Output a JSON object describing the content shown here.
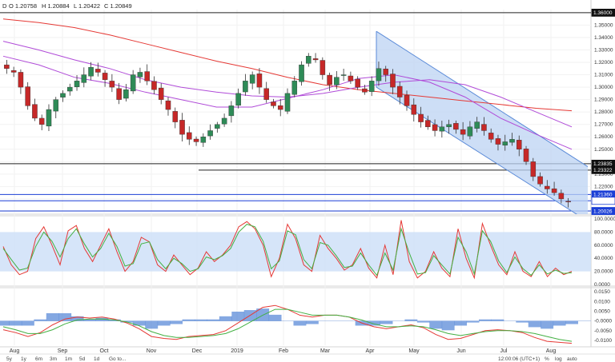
{
  "header": {
    "symbol_interval": "D",
    "open": "O 1.20758",
    "high": "H 1.20884",
    "low": "L 1.20422",
    "close": "C 1.20849"
  },
  "toolbar": {
    "ranges": [
      "5y",
      "1y",
      "6m",
      "3m",
      "1m",
      "5d",
      "1d",
      "Go to..."
    ],
    "time": "12:00:06 (UTC+1)",
    "scale_options": [
      "%",
      "log",
      "auto"
    ]
  },
  "colors": {
    "bull": "#2e8b57",
    "bear": "#c62828",
    "channel_fill": "#bcd3f3",
    "channel_line": "#5b8bd8",
    "ma_red": "#e53935",
    "ma_purple": "#b04bd8",
    "rsi_band": "#cfe0f8",
    "stoch_k": "#e53935",
    "stoch_d": "#43b043",
    "hist": "#5b8bd8"
  },
  "chart_data": [
    {
      "type": "line",
      "name": "price",
      "x_labels": [
        "Aug",
        "Sep",
        "Oct",
        "Nov",
        "Dec",
        "2019",
        "Feb",
        "Mar",
        "Apr",
        "May",
        "Jun",
        "Jul",
        "Aug"
      ],
      "y_ticks": [
        "1.35000",
        "1.34000",
        "1.33000",
        "1.32000",
        "1.31000",
        "1.30000",
        "1.29000",
        "1.28000",
        "1.27000",
        "1.26000",
        "1.25000",
        "1.24000",
        "1.23000",
        "1.22000",
        "1.21000",
        "1.20000"
      ],
      "ylim": [
        1.199,
        1.3625
      ],
      "price_labels": [
        "1.36000",
        "1.23835",
        "1.23322",
        "1.21360",
        "1.20849",
        "1.20026"
      ],
      "close_series": [
        1.315,
        1.312,
        1.3,
        1.285,
        1.275,
        1.27,
        1.282,
        1.29,
        1.295,
        1.3,
        1.305,
        1.31,
        1.316,
        1.312,
        1.306,
        1.3,
        1.29,
        1.298,
        1.31,
        1.312,
        1.305,
        1.298,
        1.29,
        1.282,
        1.272,
        1.262,
        1.258,
        1.256,
        1.26,
        1.265,
        1.27,
        1.275,
        1.285,
        1.295,
        1.305,
        1.31,
        1.3,
        1.29,
        1.285,
        1.282,
        1.295,
        1.305,
        1.318,
        1.325,
        1.322,
        1.31,
        1.302,
        1.308,
        1.31,
        1.305,
        1.3,
        1.296,
        1.305,
        1.315,
        1.31,
        1.3,
        1.292,
        1.285,
        1.278,
        1.272,
        1.268,
        1.265,
        1.268,
        1.27,
        1.266,
        1.262,
        1.268,
        1.272,
        1.265,
        1.258,
        1.254,
        1.256,
        1.258,
        1.25,
        1.24,
        1.228,
        1.222,
        1.218,
        1.215,
        1.21,
        1.208
      ],
      "moving_averages": [
        {
          "color": "red",
          "values": [
            1.355,
            1.352,
            1.348,
            1.342,
            1.335,
            1.328,
            1.321,
            1.315,
            1.308,
            1.302,
            1.298,
            1.295,
            1.292,
            1.289,
            1.286,
            1.283,
            1.281
          ]
        },
        {
          "color": "purple",
          "values": [
            1.337,
            1.33,
            1.322,
            1.315,
            1.306,
            1.3,
            1.296,
            1.293,
            1.292,
            1.295,
            1.3,
            1.304,
            1.306,
            1.302,
            1.292,
            1.28,
            1.268
          ]
        },
        {
          "color": "purple",
          "values": [
            1.325,
            1.318,
            1.308,
            1.303,
            1.296,
            1.29,
            1.284,
            1.284,
            1.291,
            1.298,
            1.307,
            1.31,
            1.304,
            1.292,
            1.275,
            1.262,
            1.25
          ]
        }
      ],
      "channel": {
        "start": "Apr",
        "upper": [
          1.345,
          1.236
        ],
        "lower": [
          1.3,
          1.192
        ]
      },
      "horizontal_lines": [
        1.36,
        1.23835,
        1.23322,
        1.2136,
        1.20849,
        1.20026
      ]
    },
    {
      "type": "line",
      "name": "oscillator",
      "y_ticks": [
        "100.0000",
        "80.0000",
        "60.0000",
        "40.0000",
        "20.0000",
        "0.0000"
      ],
      "ylim": [
        0,
        100
      ],
      "band": [
        20,
        80
      ],
      "series": [
        {
          "color": "red",
          "values": [
            58,
            30,
            15,
            20,
            70,
            88,
            60,
            30,
            82,
            90,
            55,
            35,
            60,
            85,
            50,
            20,
            35,
            72,
            65,
            30,
            20,
            45,
            30,
            15,
            25,
            50,
            35,
            45,
            60,
            88,
            96,
            85,
            60,
            12,
            40,
            92,
            70,
            30,
            20,
            75,
            55,
            40,
            22,
            30,
            55,
            25,
            10,
            60,
            15,
            98,
            35,
            10,
            20,
            50,
            25,
            12,
            85,
            40,
            10,
            93,
            60,
            30,
            15,
            50,
            20,
            12,
            35,
            12,
            25,
            15,
            20
          ]
        },
        {
          "color": "green",
          "values": [
            55,
            38,
            22,
            25,
            58,
            80,
            66,
            42,
            70,
            85,
            62,
            42,
            55,
            78,
            58,
            28,
            32,
            62,
            65,
            38,
            24,
            40,
            32,
            20,
            24,
            42,
            38,
            44,
            55,
            80,
            92,
            88,
            66,
            24,
            36,
            82,
            76,
            38,
            24,
            64,
            60,
            44,
            26,
            28,
            48,
            30,
            14,
            48,
            22,
            85,
            48,
            16,
            18,
            44,
            30,
            16,
            72,
            50,
            16,
            82,
            66,
            36,
            18,
            42,
            24,
            14,
            30,
            16,
            22,
            17,
            18
          ]
        }
      ]
    },
    {
      "type": "line",
      "name": "macd",
      "y_ticks": [
        "0.0150",
        "0.0100",
        "0.0050",
        "-0.0000",
        "-0.0050",
        "-0.0100"
      ],
      "ylim": [
        -0.0125,
        0.0155
      ],
      "series": [
        {
          "color": "red",
          "values": [
            -0.0045,
            -0.006,
            -0.008,
            -0.006,
            -0.002,
            0.001,
            0.002,
            0.0015,
            0.002,
            0.001,
            -0.001,
            -0.004,
            -0.008,
            -0.009,
            -0.0095,
            -0.008,
            -0.0075,
            -0.007,
            -0.005,
            -0.001,
            0.003,
            0.007,
            0.008,
            0.006,
            0.003,
            0.002,
            0.003,
            0.003,
            0.002,
            -0.001,
            -0.003,
            -0.004,
            -0.003,
            -0.002,
            -0.0035,
            -0.007,
            -0.0095,
            -0.009,
            -0.007,
            -0.005,
            -0.0045,
            -0.005,
            -0.006,
            -0.0085,
            -0.0105,
            -0.011,
            -0.0115
          ]
        },
        {
          "color": "green",
          "values": [
            -0.003,
            -0.0045,
            -0.0065,
            -0.0065,
            -0.0045,
            -0.0015,
            0.0005,
            0.001,
            0.001,
            0.0005,
            -0.0005,
            -0.0025,
            -0.0055,
            -0.0075,
            -0.0085,
            -0.0085,
            -0.008,
            -0.0075,
            -0.0065,
            -0.004,
            -0.0005,
            0.003,
            0.006,
            0.006,
            0.0045,
            0.003,
            0.003,
            0.003,
            0.002,
            0.0005,
            -0.0015,
            -0.003,
            -0.003,
            -0.0025,
            -0.003,
            -0.0045,
            -0.0065,
            -0.0075,
            -0.0065,
            -0.0055,
            -0.005,
            -0.005,
            -0.0055,
            -0.0065,
            -0.008,
            -0.0095,
            -0.0105
          ]
        }
      ]
    }
  ]
}
